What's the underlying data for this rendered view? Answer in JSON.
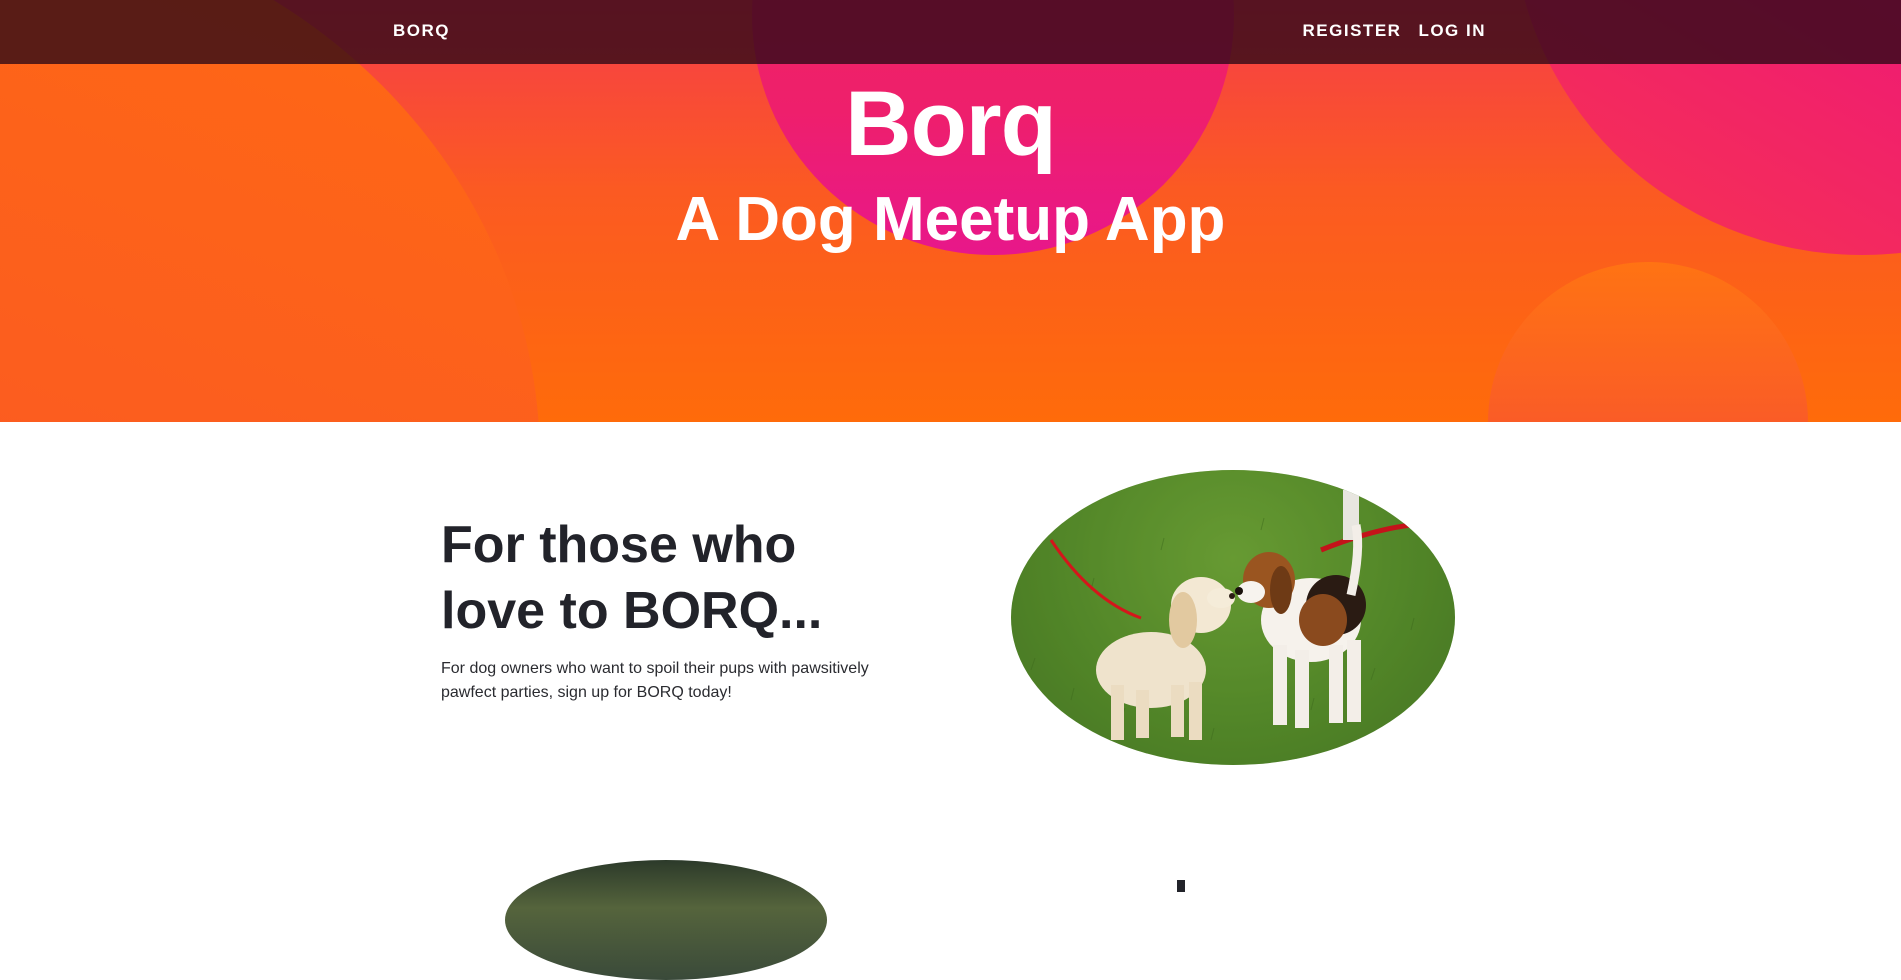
{
  "navbar": {
    "brand": "BORQ",
    "links": [
      {
        "label": "REGISTER"
      },
      {
        "label": "LOG IN"
      }
    ]
  },
  "hero": {
    "title": "Borq",
    "subtitle": "A Dog Meetup App"
  },
  "feature": {
    "heading_line1": "For those who",
    "heading_line2": "love to BORQ...",
    "text_line1": "For dog owners who want to spoil their pups with pawsitively",
    "text_line2": "pawfect parties, sign up for BORQ today!"
  },
  "colors": {
    "navbar_bg": "#2a0816",
    "hero_orange": "#ff6b0a",
    "hero_red": "#f63c4a",
    "hero_pink": "#e90d86",
    "heading_text": "#22232a"
  }
}
